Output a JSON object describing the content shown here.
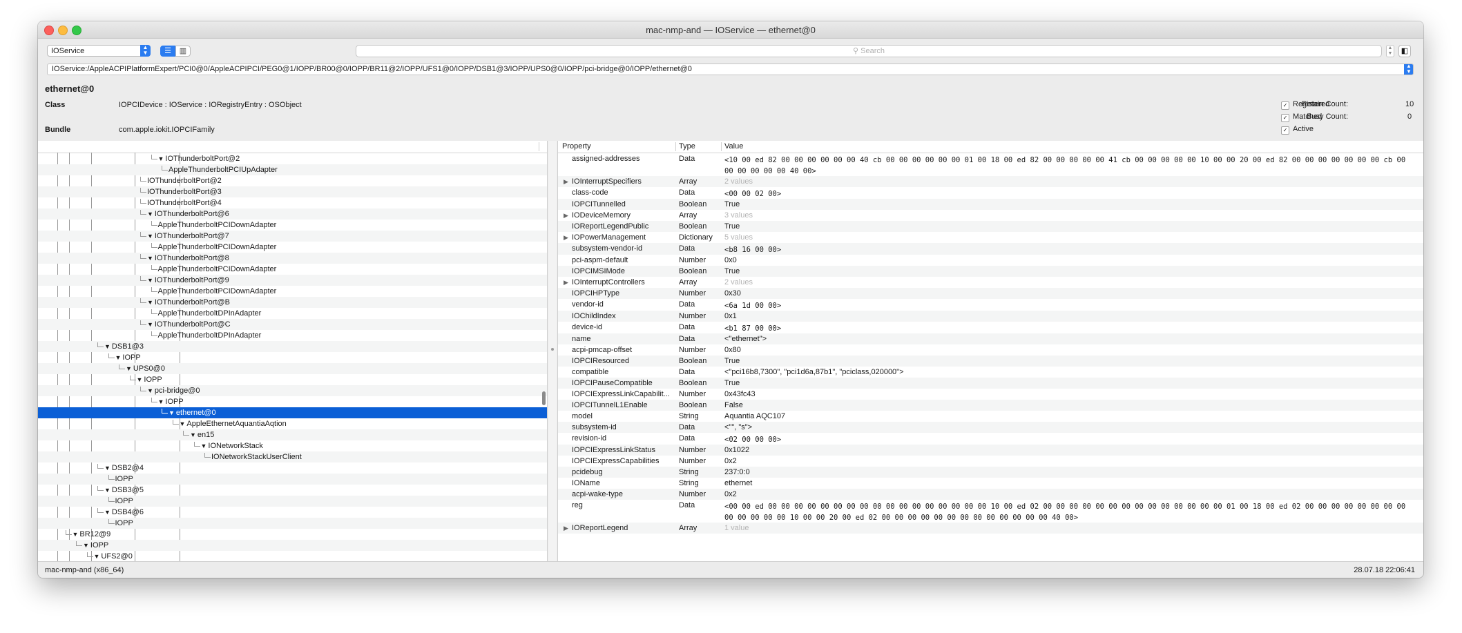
{
  "window": {
    "title": "mac-nmp-and — IOService — ethernet@0"
  },
  "toolbar": {
    "plane": "IOService",
    "search_placeholder": "Search"
  },
  "path": "IOService:/AppleACPIPlatformExpert/PCI0@0/AppleACPIPCI/PEG0@1/IOPP/BR00@0/IOPP/BR11@2/IOPP/UFS1@0/IOPP/DSB1@3/IOPP/UPS0@0/IOPP/pci-bridge@0/IOPP/ethernet@0",
  "object": {
    "name": "ethernet@0",
    "class_label": "Class",
    "class_value": "IOPCIDevice : IOService : IORegistryEntry : OSObject",
    "bundle_label": "Bundle",
    "bundle_value": "com.apple.iokit.IOPCIFamily",
    "registered": "Registered",
    "matched": "Matched",
    "active": "Active",
    "retain_label": "Retain Count:",
    "retain_value": "10",
    "busy_label": "Busy Count:",
    "busy_value": "0"
  },
  "tree": [
    {
      "label": "IOThunderboltPort@2",
      "depth": 11,
      "expanded": true
    },
    {
      "label": "AppleThunderboltPCIUpAdapter",
      "depth": 12
    },
    {
      "label": "IOThunderboltPort@2",
      "depth": 10
    },
    {
      "label": "IOThunderboltPort@3",
      "depth": 10
    },
    {
      "label": "IOThunderboltPort@4",
      "depth": 10
    },
    {
      "label": "IOThunderboltPort@6",
      "depth": 10,
      "expanded": true
    },
    {
      "label": "AppleThunderboltPCIDownAdapter",
      "depth": 11
    },
    {
      "label": "IOThunderboltPort@7",
      "depth": 10,
      "expanded": true
    },
    {
      "label": "AppleThunderboltPCIDownAdapter",
      "depth": 11
    },
    {
      "label": "IOThunderboltPort@8",
      "depth": 10,
      "expanded": true
    },
    {
      "label": "AppleThunderboltPCIDownAdapter",
      "depth": 11
    },
    {
      "label": "IOThunderboltPort@9",
      "depth": 10,
      "expanded": true
    },
    {
      "label": "AppleThunderboltPCIDownAdapter",
      "depth": 11
    },
    {
      "label": "IOThunderboltPort@B",
      "depth": 10,
      "expanded": true
    },
    {
      "label": "AppleThunderboltDPInAdapter",
      "depth": 11
    },
    {
      "label": "IOThunderboltPort@C",
      "depth": 10,
      "expanded": true
    },
    {
      "label": "AppleThunderboltDPInAdapter",
      "depth": 11
    },
    {
      "label": "DSB1@3",
      "depth": 6,
      "expanded": true
    },
    {
      "label": "IOPP",
      "depth": 7,
      "expanded": true
    },
    {
      "label": "UPS0@0",
      "depth": 8,
      "expanded": true
    },
    {
      "label": "IOPP",
      "depth": 9,
      "expanded": true
    },
    {
      "label": "pci-bridge@0",
      "depth": 10,
      "expanded": true
    },
    {
      "label": "IOPP",
      "depth": 11,
      "expanded": true
    },
    {
      "label": "ethernet@0",
      "depth": 12,
      "expanded": true,
      "selected": true
    },
    {
      "label": "AppleEthernetAquantiaAqtion",
      "depth": 13,
      "expanded": true
    },
    {
      "label": "en15",
      "depth": 14,
      "expanded": true
    },
    {
      "label": "IONetworkStack",
      "depth": 15,
      "expanded": true
    },
    {
      "label": "IONetworkStackUserClient",
      "depth": 16
    },
    {
      "label": "DSB2@4",
      "depth": 6,
      "expanded": true
    },
    {
      "label": "IOPP",
      "depth": 7
    },
    {
      "label": "DSB3@5",
      "depth": 6,
      "expanded": true
    },
    {
      "label": "IOPP",
      "depth": 7
    },
    {
      "label": "DSB4@6",
      "depth": 6,
      "expanded": true
    },
    {
      "label": "IOPP",
      "depth": 7
    },
    {
      "label": "BR12@9",
      "depth": 3,
      "expanded": true
    },
    {
      "label": "IOPP",
      "depth": 4,
      "expanded": true
    },
    {
      "label": "UFS2@0",
      "depth": 5,
      "expanded": true
    }
  ],
  "properties": {
    "headers": {
      "property": "Property",
      "type": "Type",
      "value": "Value"
    },
    "rows": [
      {
        "key": "assigned-addresses",
        "type": "Data",
        "value": "<10 00 ed 82 00 00 00 00 00 00 40 cb 00 00 00 00 00 00 01 00 18 00 ed 82 00 00 00 00 00 41 cb 00 00 00 00 00 10 00 00 20 00 ed 82 00 00 00 00 00 00 00 cb 00 00 00 00 00 00 40 00>",
        "mono": true,
        "lines": 2
      },
      {
        "key": "IOInterruptSpecifiers",
        "type": "Array",
        "value": "2 values",
        "dim": true,
        "arrow": true
      },
      {
        "key": "class-code",
        "type": "Data",
        "value": "<00 00 02 00>",
        "mono": true
      },
      {
        "key": "IOPCITunnelled",
        "type": "Boolean",
        "value": "True"
      },
      {
        "key": "IODeviceMemory",
        "type": "Array",
        "value": "3 values",
        "dim": true,
        "arrow": true
      },
      {
        "key": "IOReportLegendPublic",
        "type": "Boolean",
        "value": "True"
      },
      {
        "key": "IOPowerManagement",
        "type": "Dictionary",
        "value": "5 values",
        "dim": true,
        "arrow": true
      },
      {
        "key": "subsystem-vendor-id",
        "type": "Data",
        "value": "<b8 16 00 00>",
        "mono": true
      },
      {
        "key": "pci-aspm-default",
        "type": "Number",
        "value": "0x0"
      },
      {
        "key": "IOPCIMSIMode",
        "type": "Boolean",
        "value": "True"
      },
      {
        "key": "IOInterruptControllers",
        "type": "Array",
        "value": "2 values",
        "dim": true,
        "arrow": true
      },
      {
        "key": "IOPCIHPType",
        "type": "Number",
        "value": "0x30"
      },
      {
        "key": "vendor-id",
        "type": "Data",
        "value": "<6a 1d 00 00>",
        "mono": true
      },
      {
        "key": "IOChildIndex",
        "type": "Number",
        "value": "0x1"
      },
      {
        "key": "device-id",
        "type": "Data",
        "value": "<b1 87 00 00>",
        "mono": true
      },
      {
        "key": "name",
        "type": "Data",
        "value": "<\"ethernet\">"
      },
      {
        "key": "acpi-pmcap-offset",
        "type": "Number",
        "value": "0x80"
      },
      {
        "key": "IOPCIResourced",
        "type": "Boolean",
        "value": "True"
      },
      {
        "key": "compatible",
        "type": "Data",
        "value": "<\"pci16b8,7300\", \"pci1d6a,87b1\", \"pciclass,020000\">"
      },
      {
        "key": "IOPCIPauseCompatible",
        "type": "Boolean",
        "value": "True"
      },
      {
        "key": "IOPCIExpressLinkCapabilit...",
        "type": "Number",
        "value": "0x43fc43"
      },
      {
        "key": "IOPCITunnelL1Enable",
        "type": "Boolean",
        "value": "False"
      },
      {
        "key": "model",
        "type": "String",
        "value": "Aquantia AQC107"
      },
      {
        "key": "subsystem-id",
        "type": "Data",
        "value": "<\"\", \"s\">"
      },
      {
        "key": "revision-id",
        "type": "Data",
        "value": "<02 00 00 00>",
        "mono": true
      },
      {
        "key": "IOPCIExpressLinkStatus",
        "type": "Number",
        "value": "0x1022"
      },
      {
        "key": "IOPCIExpressCapabilities",
        "type": "Number",
        "value": "0x2"
      },
      {
        "key": "pcidebug",
        "type": "String",
        "value": "237:0:0"
      },
      {
        "key": "IOName",
        "type": "String",
        "value": "ethernet"
      },
      {
        "key": "acpi-wake-type",
        "type": "Number",
        "value": "0x2"
      },
      {
        "key": "reg",
        "type": "Data",
        "value": "<00 00 ed 00 00 00 00 00 00 00 00 00 00 00 00 00 00 00 00 00 10 00 ed 02 00 00 00 00 00 00 00 00 00 00 00 00 00 00 01 00 18 00 ed 02 00 00 00 00 00 00 00 00 00 00 00 00 00 10 00 00 20 00 ed 02 00 00 00 00 00 00 00 00 00 00 00 00 00 40 00>",
        "mono": true,
        "lines": 2
      },
      {
        "key": "IOReportLegend",
        "type": "Array",
        "value": "1 value",
        "dim": true,
        "arrow": true
      }
    ]
  },
  "status": {
    "machine": "mac-nmp-and (x86_64)",
    "timestamp": "28.07.18 22:06:41"
  }
}
